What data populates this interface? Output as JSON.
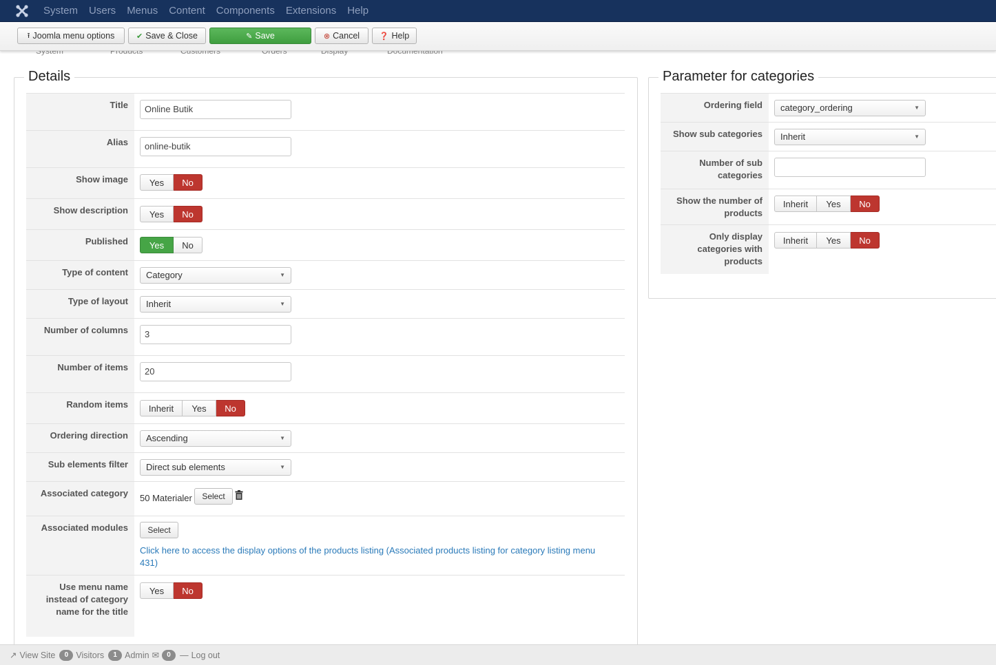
{
  "navbar": {
    "items": [
      "System",
      "Users",
      "Menus",
      "Content",
      "Components",
      "Extensions",
      "Help"
    ]
  },
  "toolbar": {
    "menu_options": "Joomla menu options",
    "save_close": "Save & Close",
    "save": "Save",
    "cancel": "Cancel",
    "help": "Help"
  },
  "substrip": {
    "items": [
      "System",
      "Products",
      "Customers",
      "Orders",
      "Display",
      "Documentation"
    ]
  },
  "details": {
    "legend": "Details",
    "title_label": "Title",
    "title_value": "Online Butik",
    "alias_label": "Alias",
    "alias_value": "online-butik",
    "show_image_label": "Show image",
    "show_description_label": "Show description",
    "published_label": "Published",
    "type_content_label": "Type of content",
    "type_content_value": "Category",
    "type_layout_label": "Type of layout",
    "type_layout_value": "Inherit",
    "num_columns_label": "Number of columns",
    "num_columns_value": "3",
    "num_items_label": "Number of items",
    "num_items_value": "20",
    "random_items_label": "Random items",
    "ordering_direction_label": "Ordering direction",
    "ordering_direction_value": "Ascending",
    "sub_filter_label": "Sub elements filter",
    "sub_filter_value": "Direct sub elements",
    "assoc_category_label": "Associated category",
    "assoc_category_value": "50 Materialer",
    "assoc_modules_label": "Associated modules",
    "select_label": "Select",
    "link_text": "Click here to access the display options of the products listing (Associated products listing for category listing menu 431)",
    "use_menu_name_label": "Use menu name instead of category name for the title",
    "yes": "Yes",
    "no": "No",
    "inherit": "Inherit"
  },
  "params": {
    "legend": "Parameter for categories",
    "ordering_field_label": "Ordering field",
    "ordering_field_value": "category_ordering",
    "show_sub_label": "Show sub categories",
    "show_sub_value": "Inherit",
    "num_sub_label": "Number of sub categories",
    "num_sub_value": "",
    "show_num_products_label": "Show the number of products",
    "only_display_label": "Only display categories with products"
  },
  "footer": {
    "view_site": "View Site",
    "visitors_count": "0",
    "visitors": "Visitors",
    "admin_count": "1",
    "admin": "Admin",
    "messages_count": "0",
    "logout": "Log out"
  }
}
